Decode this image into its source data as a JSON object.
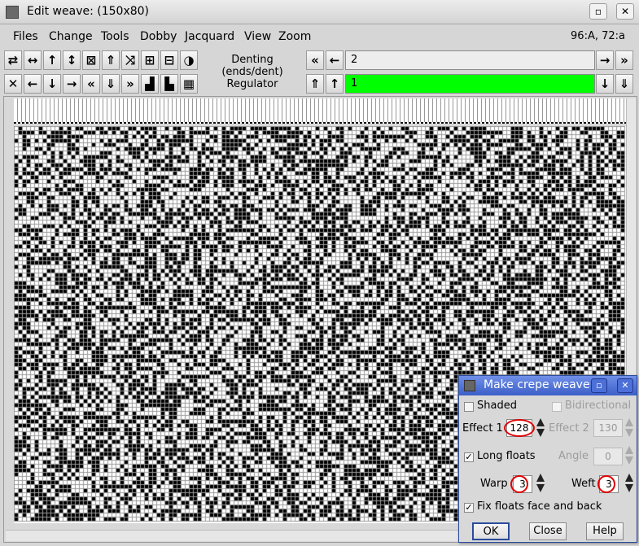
{
  "window": {
    "title": "Edit weave:  (150x80)",
    "min_label": "▫",
    "close_label": "✕"
  },
  "menu": {
    "files": "Files",
    "change": "Change",
    "tools": "Tools",
    "dobby": "Dobby",
    "jacquard": "Jacquard",
    "view": "View",
    "zoom": "Zoom"
  },
  "status": {
    "position": "96:A,  72:a"
  },
  "toolbar": {
    "row1_icons": [
      "⇄",
      "↔",
      "↑",
      "↕",
      "⊠",
      "⇑",
      "⤨",
      "⊞",
      "⊟",
      "◑"
    ],
    "row2_icons": [
      "✕",
      "←",
      "↓",
      "→",
      "«",
      "⇓",
      "»",
      "▟",
      "▙",
      "▦"
    ],
    "denting_label": "Denting (ends/dent)",
    "regulator_label": "Regulator",
    "denting_value": "2",
    "regulator_value": "1",
    "fast_left": "«",
    "left": "←",
    "right": "→",
    "fast_right": "»",
    "fast_up": "⇑",
    "up": "↑",
    "down": "↓",
    "fast_down": "⇓"
  },
  "colors": {
    "regulator_bg": "#00ff00",
    "dialog_title": "#3c5fc8",
    "highlight": "#e00000"
  },
  "weave": {
    "threads": 150,
    "picks": 80
  },
  "dialog": {
    "title": "Make crepe weave",
    "shaded_label": "Shaded",
    "bidirectional_label": "Bidirectional",
    "effect1_label": "Effect 1",
    "effect1_value": "128",
    "effect2_label": "Effect 2",
    "effect2_value": "130",
    "long_floats_label": "Long floats",
    "angle_label": "Angle",
    "angle_value": "0",
    "warp_label": "Warp",
    "warp_value": "3",
    "weft_label": "Weft",
    "weft_value": "3",
    "fix_floats_label": "Fix floats face and back",
    "ok_label": "OK",
    "close_label": "Close",
    "help_label": "Help",
    "check_mark": "✓"
  }
}
